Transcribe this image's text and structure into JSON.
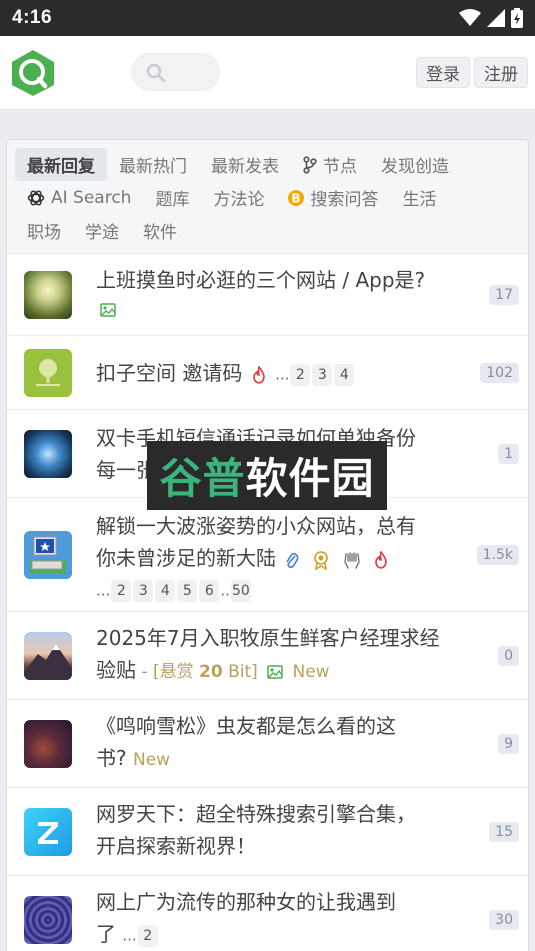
{
  "statusbar": {
    "time": "4:16"
  },
  "header": {
    "search_placeholder": "",
    "login_label": "登录",
    "register_label": "注册"
  },
  "tabs": {
    "row1": [
      "最新回复",
      "最新热门",
      "最新发表",
      "节点",
      "发现创造"
    ],
    "row2": [
      "AI Search",
      "题库",
      "方法论",
      "搜索问答",
      "生活"
    ],
    "row3": [
      "职场",
      "学途",
      "软件"
    ]
  },
  "topics": [
    {
      "title": "上班摸鱼时必逛的三个网站 / App是?",
      "count": "17"
    },
    {
      "title": "扣子空间 邀请码",
      "pages": [
        "...",
        "2",
        "3",
        "4"
      ],
      "count": "102"
    },
    {
      "title_line1": "双卡手机短信通话记录如何单独备份",
      "title_line2": "每一张卡的数据",
      "count": "1"
    },
    {
      "title_line1": "解锁一大波涨姿势的小众网站，总有",
      "title_line2": "你未曾涉足的新大陆",
      "pages": [
        "...",
        "2",
        "3",
        "4",
        "5",
        "6",
        "..",
        "50"
      ],
      "count": "1.5k"
    },
    {
      "title_line1": "2025年7月入职牧原生鲜客户经理求经",
      "title_line2": "验贴",
      "meta_sep": " - ",
      "reward_open": "[悬赏 ",
      "reward_amount": "20",
      "reward_unit": " Bit]",
      "new_label": "New",
      "count": "0"
    },
    {
      "title_line1": "《鸣响雪松》虫友都是怎么看的这",
      "title_line2": "书?",
      "new_label": "New",
      "count": "9"
    },
    {
      "title_line1": "网罗天下：超全特殊搜索引擎合集，",
      "title_line2": "开启探索新视界！",
      "count": "15"
    },
    {
      "title_line1": "网上广为流传的那种女的让我遇到",
      "title_line2": "了",
      "pages": [
        "...",
        "2"
      ],
      "count": "30"
    }
  ],
  "watermark": {
    "part1": "谷普",
    "part2": "软件园"
  },
  "colors": {
    "brand": "#4caf50",
    "accent": "#b8a25b",
    "statusbar": "#2b2b2b"
  }
}
